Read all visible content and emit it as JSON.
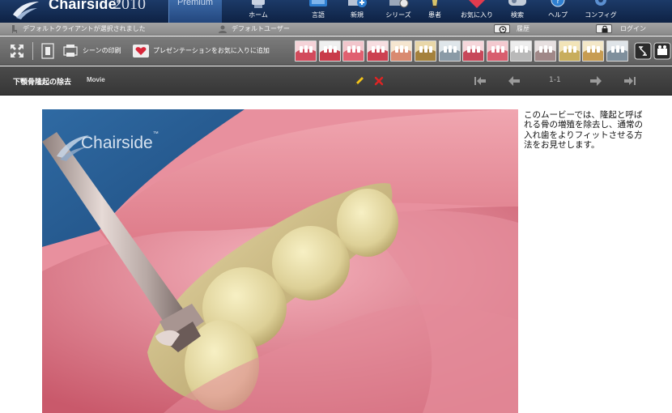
{
  "app": {
    "brand": "Chairside",
    "year": "2010",
    "edition": "Premium",
    "brand_color": "#1c3a68"
  },
  "nav": [
    {
      "label": "ホーム",
      "icon": "home-icon"
    },
    {
      "label": "言語",
      "icon": "globe-icon"
    },
    {
      "label": "新規",
      "icon": "new-icon"
    },
    {
      "label": "シリーズ",
      "icon": "film-icon"
    },
    {
      "label": "患者",
      "icon": "patient-icon"
    },
    {
      "label": "お気に入り",
      "icon": "heart-icon"
    },
    {
      "label": "検索",
      "icon": "search-icon"
    },
    {
      "label": "ヘルプ",
      "icon": "help-icon"
    },
    {
      "label": "コンフィグ",
      "icon": "gear-icon"
    }
  ],
  "status": {
    "client": "デフォルトクライアントが選択されました",
    "user": "デフォルトユーザー",
    "history": "履歴",
    "login": "ログイン"
  },
  "toolbar": {
    "print_scene": "シーンの印刷",
    "add_favorite": "プレゼンテーションをお気に入りに追加",
    "thumbnail_count": 14
  },
  "title": {
    "text": "下顎骨隆起の除去",
    "type": "Movie",
    "page_indicator": "1-1"
  },
  "movie": {
    "watermark": "Chairside",
    "watermark_tm": "™"
  },
  "description": "このムービーでは、隆起と呼ばれる骨の増殖を除去し、通常の入れ歯をよりフィットさせる方法をお見せします。"
}
